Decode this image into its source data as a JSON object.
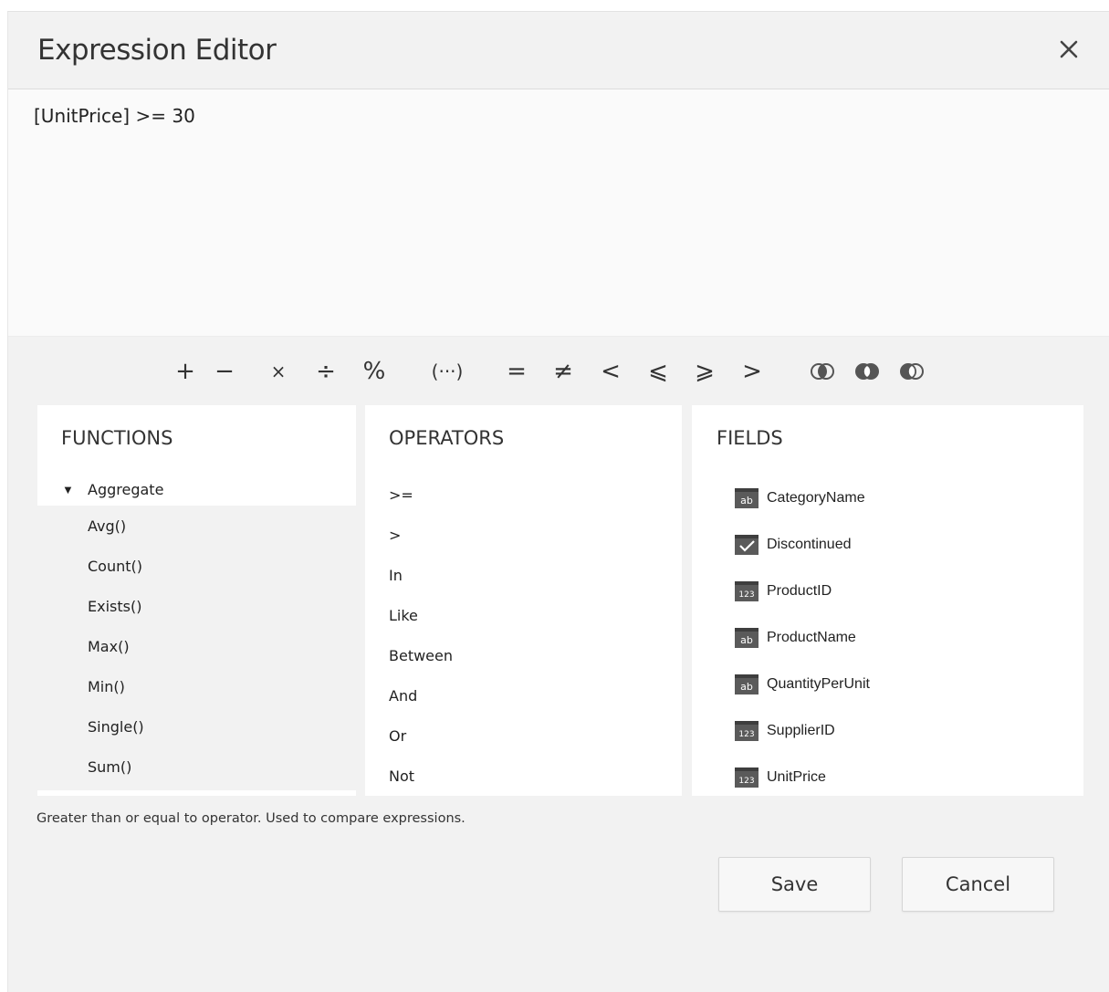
{
  "dialog": {
    "title": "Expression Editor",
    "close_icon": "close-icon"
  },
  "editor": {
    "expression": "[UnitPrice] >= 30"
  },
  "toolbar": {
    "buttons": [
      {
        "symbol": "+",
        "name": "plus"
      },
      {
        "symbol": "−",
        "name": "minus"
      },
      {
        "symbol": "×",
        "name": "multiply"
      },
      {
        "symbol": "÷",
        "name": "divide"
      },
      {
        "symbol": "%",
        "name": "modulo"
      },
      {
        "symbol": "(···)",
        "name": "parentheses"
      },
      {
        "symbol": "=",
        "name": "equal"
      },
      {
        "symbol": "≠",
        "name": "not-equal"
      },
      {
        "symbol": "<",
        "name": "less-than"
      },
      {
        "symbol": "⩽",
        "name": "less-or-equal"
      },
      {
        "symbol": "⩾",
        "name": "greater-or-equal"
      },
      {
        "symbol": ">",
        "name": "greater-than"
      }
    ],
    "logic_icons": [
      "and-icon",
      "or-icon",
      "not-icon"
    ]
  },
  "functions": {
    "title": "FUNCTIONS",
    "group": {
      "label": "Aggregate",
      "expanded": true
    },
    "items": [
      "Avg()",
      "Count()",
      "Exists()",
      "Max()",
      "Min()",
      "Single()",
      "Sum()"
    ]
  },
  "operators": {
    "title": "OPERATORS",
    "items": [
      ">=",
      ">",
      "In",
      "Like",
      "Between",
      "And",
      "Or",
      "Not"
    ]
  },
  "fields": {
    "title": "FIELDS",
    "items": [
      {
        "label": "CategoryName",
        "type": "string",
        "icon": "string-field-icon"
      },
      {
        "label": "Discontinued",
        "type": "boolean",
        "icon": "boolean-field-icon"
      },
      {
        "label": "ProductID",
        "type": "number",
        "icon": "number-field-icon"
      },
      {
        "label": "ProductName",
        "type": "string",
        "icon": "string-field-icon"
      },
      {
        "label": "QuantityPerUnit",
        "type": "string",
        "icon": "string-field-icon"
      },
      {
        "label": "SupplierID",
        "type": "number",
        "icon": "number-field-icon"
      },
      {
        "label": "UnitPrice",
        "type": "number",
        "icon": "number-field-icon"
      }
    ]
  },
  "description": "Greater than or equal to operator. Used to compare expressions.",
  "actions": {
    "save_label": "Save",
    "cancel_label": "Cancel"
  },
  "colors": {
    "dialog_bg": "#f2f2f2",
    "panel_bg": "#ffffff",
    "editor_bg": "#fafafa",
    "icon_gray": "#555555",
    "text": "#222222"
  }
}
